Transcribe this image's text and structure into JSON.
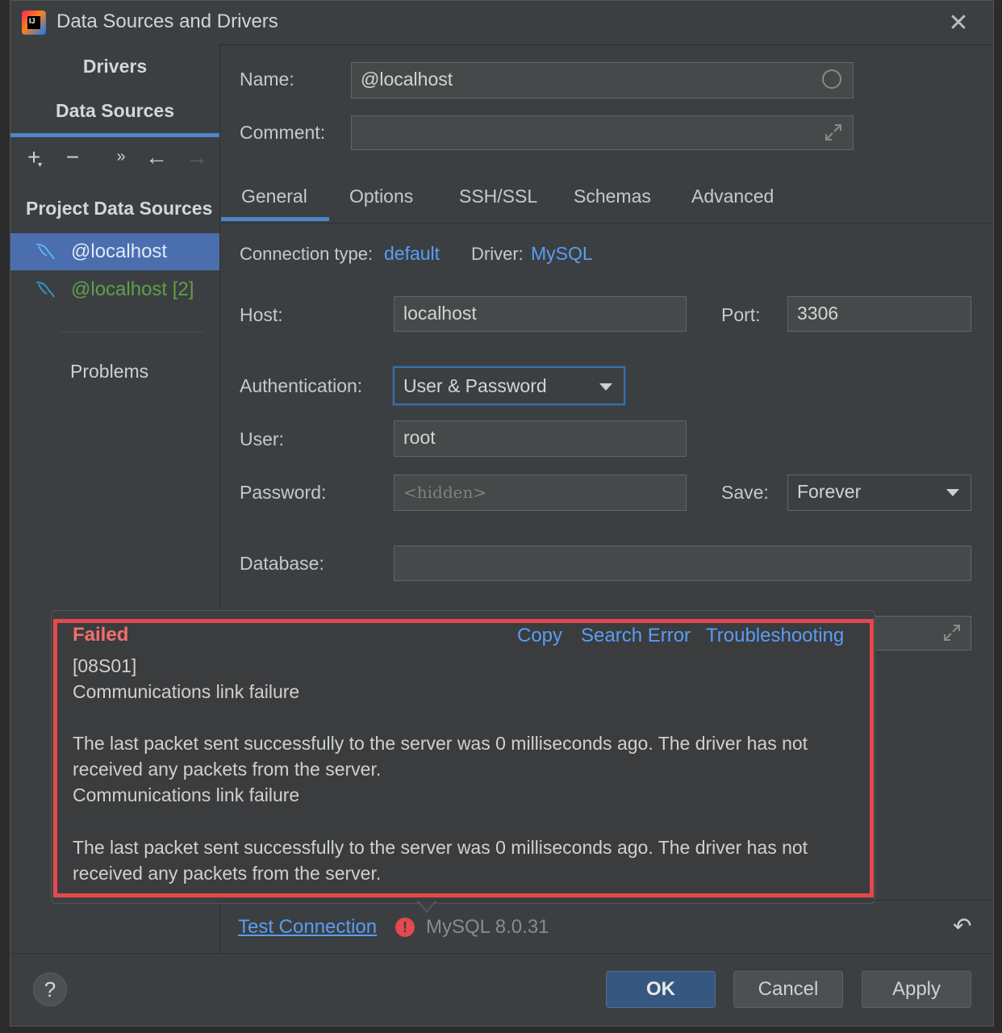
{
  "window": {
    "title": "Data Sources and Drivers",
    "close_glyph": "✕"
  },
  "sidebar": {
    "tabs": [
      "Drivers",
      "Data Sources"
    ],
    "toolbar": {
      "add": "+",
      "remove": "−",
      "more": "»",
      "back": "←",
      "forward": "→"
    },
    "section_title": "Project Data Sources",
    "items": [
      {
        "label": "@localhost",
        "selected": true
      },
      {
        "label": "@localhost [2]",
        "selected": false,
        "color": "#5ea04a"
      }
    ],
    "problems_label": "Problems"
  },
  "form": {
    "name_label": "Name:",
    "name_value": "@localhost",
    "comment_label": "Comment:",
    "comment_value": "",
    "tabs": [
      "General",
      "Options",
      "SSH/SSL",
      "Schemas",
      "Advanced"
    ],
    "connection_type_label": "Connection type:",
    "connection_type_value": "default",
    "driver_label": "Driver:",
    "driver_value": "MySQL",
    "host_label": "Host:",
    "host_value": "localhost",
    "port_label": "Port:",
    "port_value": "3306",
    "auth_label": "Authentication:",
    "auth_value": "User & Password",
    "user_label": "User:",
    "user_value": "root",
    "password_label": "Password:",
    "password_placeholder": "<hidden>",
    "save_label": "Save:",
    "save_value": "Forever",
    "database_label": "Database:",
    "database_value": ""
  },
  "error_popup": {
    "title": "Failed",
    "actions": [
      "Copy",
      "Search Error",
      "Troubleshooting"
    ],
    "lines": [
      "[08S01]",
      "Communications link failure",
      "",
      "The last packet sent successfully to the server was 0 milliseconds ago. The driver has not",
      "received any packets from the server.",
      "Communications link failure",
      "",
      "The last packet sent successfully to the server was 0 milliseconds ago. The driver has not",
      "received any packets from the server."
    ]
  },
  "status": {
    "test_connection": "Test Connection",
    "error_glyph": "!",
    "driver_version": "MySQL 8.0.31",
    "revert_glyph": "↶"
  },
  "footer": {
    "help": "?",
    "ok": "OK",
    "cancel": "Cancel",
    "apply": "Apply"
  },
  "colors": {
    "accent": "#4a88c7",
    "link": "#589df6",
    "error": "#e5484d",
    "selection": "#4b6eaf"
  }
}
